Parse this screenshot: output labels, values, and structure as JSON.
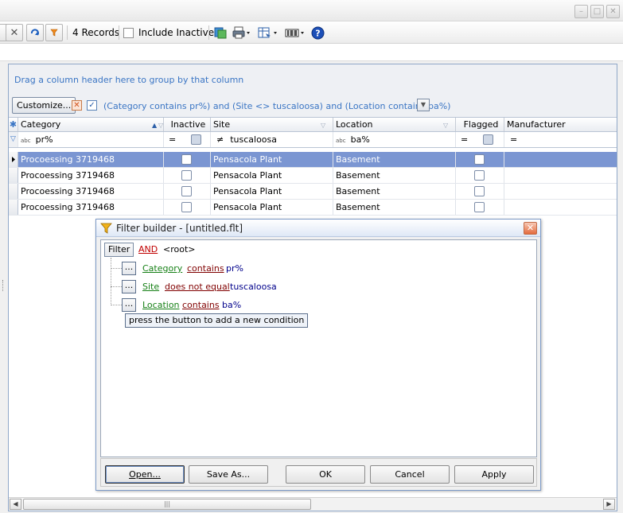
{
  "toolbar": {
    "records": "4 Records",
    "include_inactive": "Include Inactive"
  },
  "grid": {
    "group_hint": "Drag a column header here to group by that column",
    "customize": "Customize...",
    "filter_text": "(Category contains pr%) and (Site <> tuscaloosa) and (Location contains ba%)",
    "columns": [
      "Category",
      "Inactive",
      "Site",
      "Location",
      "Flagged",
      "Manufacturer"
    ],
    "filter_row": {
      "category": "pr%",
      "inactive_op": "=",
      "site_op": "≠",
      "site": "tuscaloosa",
      "location": "ba%",
      "flagged_op": "=",
      "manufacturer_op": "="
    },
    "abc": "abc",
    "rows": [
      {
        "category": "Procoessing 3719468",
        "site": "Pensacola Plant",
        "location": "Basement"
      },
      {
        "category": "Procoessing 3719468",
        "site": "Pensacola Plant",
        "location": "Basement"
      },
      {
        "category": "Procoessing 3719468",
        "site": "Pensacola Plant",
        "location": "Basement"
      },
      {
        "category": "Procoessing 3719468",
        "site": "Pensacola Plant",
        "location": "Basement"
      }
    ],
    "scroll_grip": "|||"
  },
  "dialog": {
    "title": "Filter builder - [untitled.flt]",
    "filter_btn": "Filter",
    "root_op": "AND",
    "root": "<root>",
    "dots": "...",
    "conditions": [
      {
        "field": "Category",
        "op": "contains",
        "value": "pr%"
      },
      {
        "field": "Site",
        "op": "does not equal",
        "value": "tuscaloosa"
      },
      {
        "field": "Location",
        "op": "contains",
        "value": "ba%"
      }
    ],
    "add_hint": "press the button to add a new condition",
    "buttons": {
      "open": "Open...",
      "save_as": "Save As...",
      "ok": "OK",
      "cancel": "Cancel",
      "apply": "Apply"
    }
  },
  "colors": {
    "selected_row": "#7b96d2",
    "link_blue": "#3a75c4",
    "and_red": "#c00000",
    "field_green": "#168016"
  }
}
